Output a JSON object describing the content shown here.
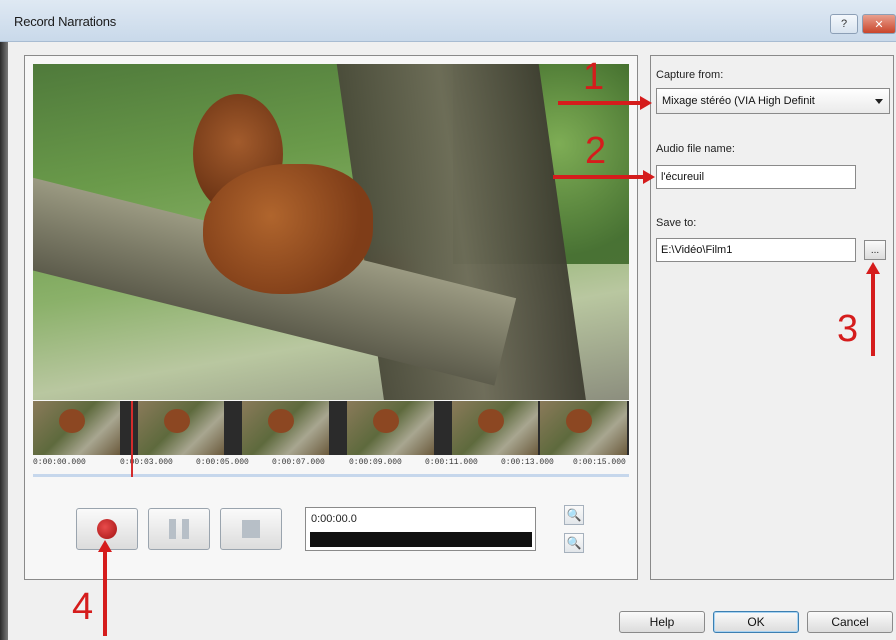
{
  "window": {
    "title": "Record Narrations",
    "help_glyph": "?",
    "close_glyph": "✕"
  },
  "timeline": {
    "ticks": [
      "0:00:00.000",
      "0:00:03.000",
      "0:00:05.000",
      "0:00:07.000",
      "0:00:09.000",
      "0:00:11.000",
      "0:00:13.000",
      "0:00:15.000"
    ]
  },
  "transport": {
    "counter_text": "0:00:00.0",
    "icons": [
      "record-icon",
      "pause-icon",
      "stop-icon",
      "zoom-out-icon",
      "zoom-in-icon"
    ]
  },
  "capture": {
    "label": "Capture from:",
    "selected": "Mixage stéréo (VIA High Definit"
  },
  "audio_file": {
    "label": "Audio file name:",
    "value": "l'écureuil"
  },
  "save_to": {
    "label": "Save to:",
    "value": "E:\\Vidéo\\Film1",
    "browse_label": "..."
  },
  "dialog_buttons": {
    "help": "Help",
    "ok": "OK",
    "cancel": "Cancel"
  },
  "annotations": {
    "n1": "1",
    "n2": "2",
    "n3": "3",
    "n4": "4"
  },
  "colors": {
    "annotation_red": "#d51c1c",
    "record_red": "#c21f1f",
    "titlebar": "#d3e1ef"
  }
}
